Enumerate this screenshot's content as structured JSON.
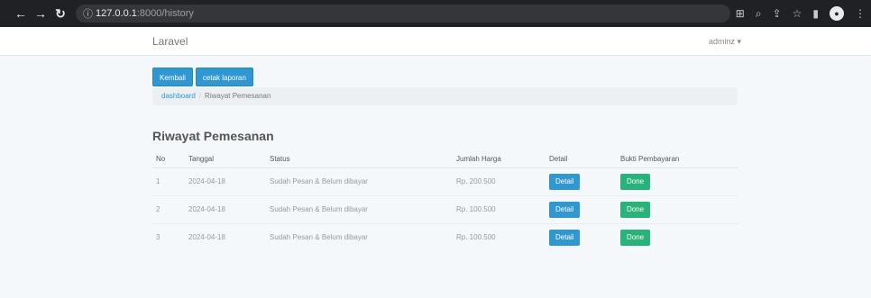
{
  "browser": {
    "url_host": "127.0.0.1",
    "url_path": ":8000/history",
    "profile_initial": "●"
  },
  "navbar": {
    "brand": "Laravel",
    "user": "adminz ▾"
  },
  "actions": {
    "back_label": "Kembali",
    "report_label": "cetak laporan"
  },
  "breadcrumb": {
    "home": "dashboard",
    "separator": "/",
    "current": "Riwayat Pemesanan"
  },
  "page": {
    "title": "Riwayat Pemesanan"
  },
  "table": {
    "headers": [
      "No",
      "Tanggal",
      "Status",
      "Jumlah Harga",
      "Detail",
      "Bukti Pembayaran"
    ],
    "rows": [
      {
        "no": "1",
        "tanggal": "2024-04-18",
        "status": "Sudah Pesan & Belum dibayar",
        "harga": "Rp. 200.500",
        "detail": "Detail",
        "bukti": "Done"
      },
      {
        "no": "2",
        "tanggal": "2024-04-18",
        "status": "Sudah Pesan & Belum dibayar",
        "harga": "Rp. 100.500",
        "detail": "Detail",
        "bukti": "Done"
      },
      {
        "no": "3",
        "tanggal": "2024-04-18",
        "status": "Sudah Pesan & Belum dibayar",
        "harga": "Rp. 100.500",
        "detail": "Detail",
        "bukti": "Done"
      }
    ]
  },
  "icons": {
    "back": "back-arrow-icon",
    "forward": "forward-arrow-icon",
    "reload": "reload-icon",
    "info": "info-icon",
    "translate": "translate-icon",
    "zoom": "zoom-icon",
    "share": "share-icon",
    "bookmark": "star-icon",
    "sidebar": "side-panel-icon",
    "menu": "kebab-menu-icon"
  },
  "colors": {
    "primary": "#3097d1",
    "success": "#2ab27b",
    "chrome_bg": "#202124"
  }
}
